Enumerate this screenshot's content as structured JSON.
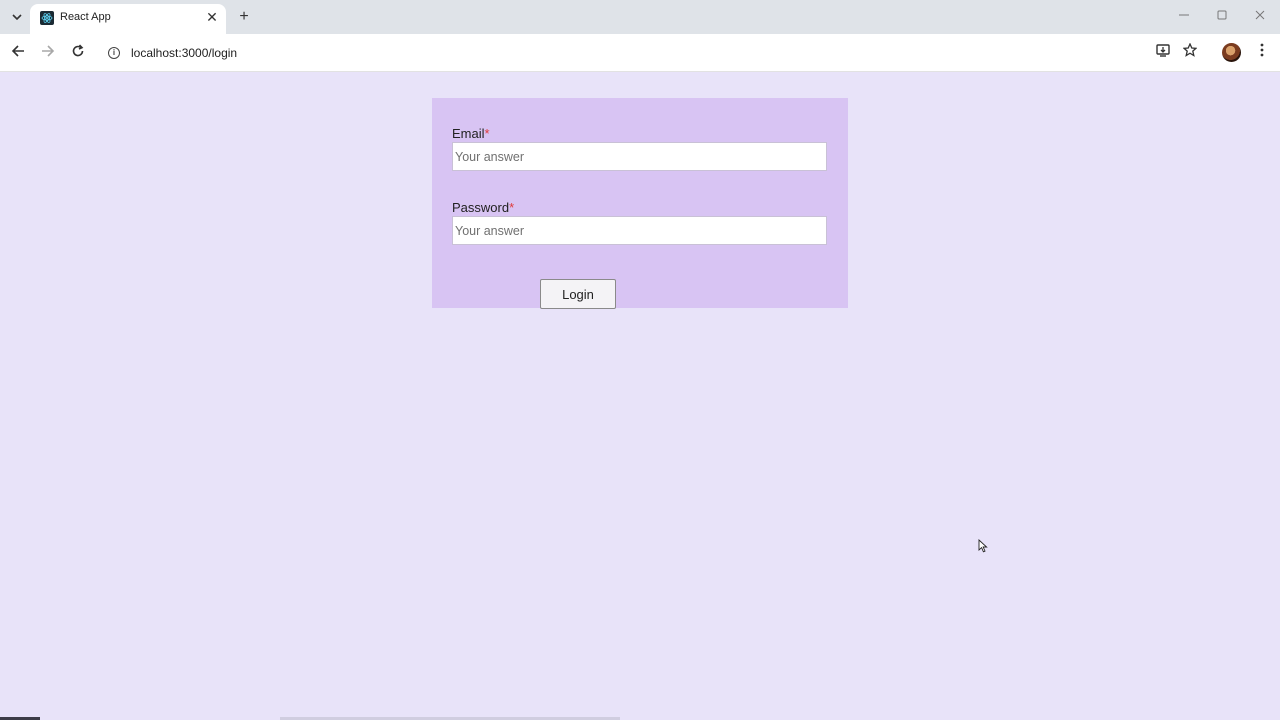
{
  "browser": {
    "tab_title": "React App",
    "tab_close_glyph": "✕",
    "new_tab_glyph": "+",
    "tab_list_glyph": "⌄",
    "url": "localhost:3000/login",
    "icons": {
      "back": "arrow-left-icon",
      "forward": "arrow-right-icon",
      "reload": "reload-icon",
      "site_info": "info-icon",
      "install": "install-app-icon",
      "bookmark": "star-icon",
      "menu": "kebab-menu-icon"
    }
  },
  "form": {
    "email_label": "Email",
    "email_required_mark": "*",
    "email_placeholder": "Your answer",
    "email_value": "",
    "password_label": "Password",
    "password_required_mark": "*",
    "password_placeholder": "Your answer",
    "password_value": "",
    "login_label": "Login"
  },
  "colors": {
    "page_background": "#e8e3f9",
    "form_background": "#d8c4f3",
    "required_mark": "#e03a3a",
    "tabbar_background": "#dfe3e8"
  }
}
